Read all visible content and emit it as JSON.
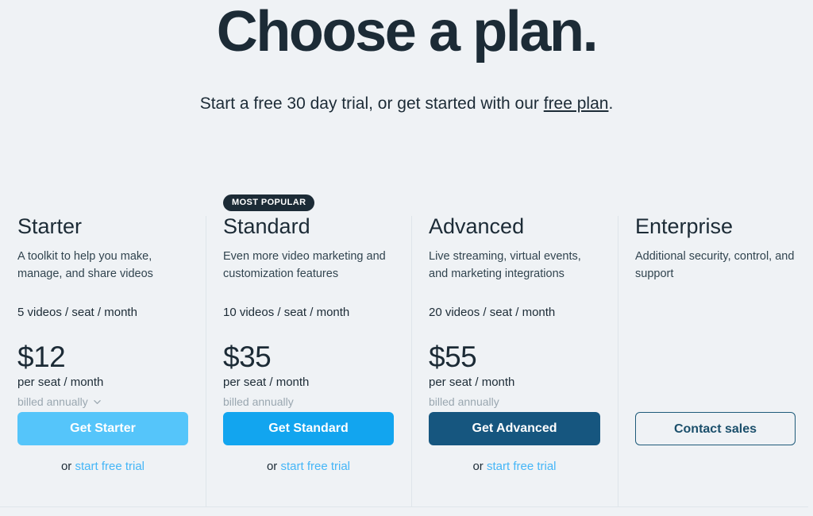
{
  "hero": {
    "title": "Choose a plan.",
    "subtitle_before": "Start a free 30 day trial, or get started with our ",
    "free_plan_link": "free plan",
    "subtitle_after": "."
  },
  "badge": {
    "most_popular": "MOST POPULAR"
  },
  "trial": {
    "or_prefix": "or ",
    "link_label": "start free trial"
  },
  "colors": {
    "background": "#eff2f5",
    "text": "#1c2b36",
    "muted": "#9aa7b0",
    "divider": "#dfe5ea",
    "link_blue": "#45b6f7",
    "starter_button": "#55c5fa",
    "standard_button": "#12a5ef",
    "advanced_button": "#16567f",
    "enterprise_border": "#1f5b7a"
  },
  "plans": [
    {
      "name": "Starter",
      "description": "A toolkit to help you make, manage, and share videos",
      "quota": "5 videos / seat / month",
      "price": "$12",
      "price_unit": "per seat / month",
      "billing": "billed annually",
      "has_billing_chevron": true,
      "cta_label": "Get Starter",
      "cta_style": "filled",
      "cta_color": "#55c5fa",
      "has_trial_link": true,
      "badge": null
    },
    {
      "name": "Standard",
      "description": "Even more video marketing and customization features",
      "quota": "10 videos / seat / month",
      "price": "$35",
      "price_unit": "per seat / month",
      "billing": "billed annually",
      "has_billing_chevron": false,
      "cta_label": "Get Standard",
      "cta_style": "filled",
      "cta_color": "#12a5ef",
      "has_trial_link": true,
      "badge": "MOST POPULAR"
    },
    {
      "name": "Advanced",
      "description": "Live streaming, virtual events, and marketing integrations",
      "quota": "20 videos / seat / month",
      "price": "$55",
      "price_unit": "per seat / month",
      "billing": "billed annually",
      "has_billing_chevron": false,
      "cta_label": "Get Advanced",
      "cta_style": "filled",
      "cta_color": "#16567f",
      "has_trial_link": true,
      "badge": null
    },
    {
      "name": "Enterprise",
      "description": "Additional security, control, and support",
      "quota": "",
      "price": "",
      "price_unit": "",
      "billing": "",
      "has_billing_chevron": false,
      "cta_label": "Contact sales",
      "cta_style": "outline",
      "cta_color": "#1f5b7a",
      "has_trial_link": false,
      "badge": null
    }
  ]
}
